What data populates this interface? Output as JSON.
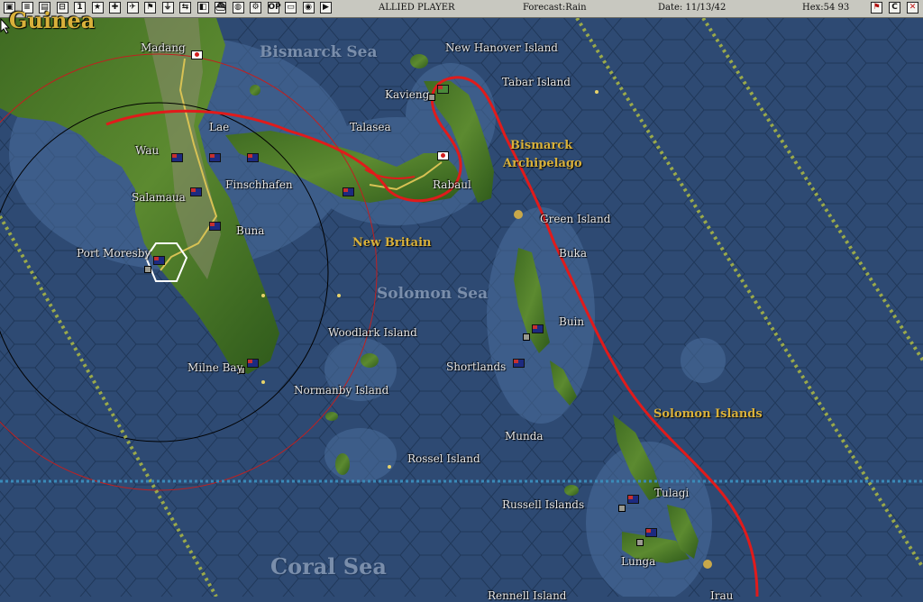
{
  "toolbar": {
    "side": "ALLIED PLAYER",
    "forecast": "Forecast:Rain",
    "date": "Date: 11/13/42",
    "hex": "Hex:54 93",
    "left_buttons": [
      {
        "name": "map-icon",
        "glyph": "▣"
      },
      {
        "name": "report-icon",
        "glyph": "≡"
      },
      {
        "name": "list-icon",
        "glyph": "▤"
      },
      {
        "name": "ship-list-icon",
        "glyph": "⊟"
      },
      {
        "name": "info-icon",
        "glyph": "1"
      },
      {
        "name": "star-icon",
        "glyph": "★"
      },
      {
        "name": "air-icon",
        "glyph": "✚"
      },
      {
        "name": "aircraft-icon",
        "glyph": "✈"
      },
      {
        "name": "flag-icon",
        "glyph": "⚑"
      },
      {
        "name": "sub-icon",
        "glyph": "⏚"
      },
      {
        "name": "transfer-icon",
        "glyph": "⇆"
      },
      {
        "name": "color-icon",
        "glyph": "◧"
      },
      {
        "name": "convoy-icon",
        "glyph": "⛴"
      },
      {
        "name": "globe-icon",
        "glyph": "◍"
      },
      {
        "name": "gear-icon",
        "glyph": "⚙"
      },
      {
        "name": "op-icon",
        "glyph": "OP"
      },
      {
        "name": "save-icon",
        "glyph": "▭"
      },
      {
        "name": "disk-icon",
        "glyph": "◉"
      },
      {
        "name": "play-icon",
        "glyph": "▶"
      }
    ],
    "right_buttons": [
      {
        "name": "flag-view-icon",
        "glyph": "⚑"
      },
      {
        "name": "center-icon",
        "glyph": "C"
      },
      {
        "name": "close-icon",
        "glyph": "✕"
      }
    ]
  },
  "map": {
    "seas": {
      "bismarck": "Bismarck Sea",
      "solomon": "Solomon Sea",
      "coral": "Coral Sea",
      "guinea": "Guinea"
    },
    "regions": {
      "archipelago_1": "Bismarck",
      "archipelago_2": "Archipelago",
      "new_britain": "New Britain",
      "solomon_islands": "Solomon Islands"
    },
    "places": {
      "madang": "Madang",
      "new_hanover": "New Hanover Island",
      "tabar": "Tabar Island",
      "kavieng": "Kavieng",
      "talasea": "Talasea",
      "lae": "Lae",
      "wau": "Wau",
      "finschhafen": "Finschhafen",
      "rabaul": "Rabaul",
      "salamaua": "Salamaua",
      "green_island": "Green Island",
      "buna": "Buna",
      "port_moresby": "Port Moresby",
      "buka": "Buka",
      "buin": "Buin",
      "woodlark": "Woodlark Island",
      "milne_bay": "Milne Bay",
      "shortlands": "Shortlands",
      "normanby": "Normanby Island",
      "munda": "Munda",
      "rossel": "Rossel Island",
      "russell": "Russell Islands",
      "tulagi": "Tulagi",
      "lunga": "Lunga",
      "rennell": "Rennell Island",
      "tarau": "Irau"
    }
  }
}
